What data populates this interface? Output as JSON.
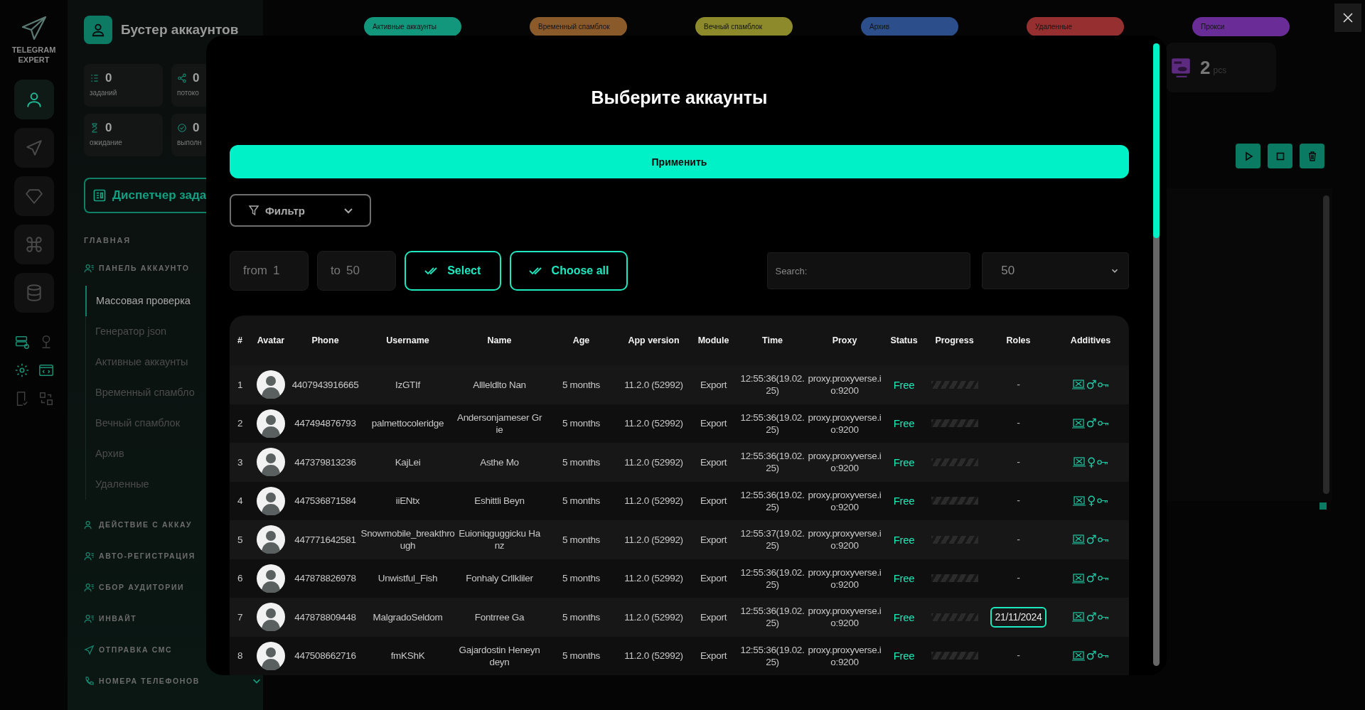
{
  "rail": {
    "logo_text": "TELEGRAM EXPERT",
    "items": [
      {
        "selected": true
      },
      {
        "selected": false
      },
      {
        "selected": false
      },
      {
        "selected": false
      },
      {
        "selected": false
      }
    ]
  },
  "sidebar": {
    "title": "Бустер аккаунтов",
    "stats": [
      {
        "value": "0",
        "label": "заданий"
      },
      {
        "value": "0",
        "label": "потоко"
      },
      {
        "value": "0",
        "label": "ожидание"
      },
      {
        "value": "0",
        "label": "выполн"
      }
    ],
    "dispatcher": "Диспетчер зада",
    "section": "ГЛАВНАЯ",
    "menu": [
      {
        "label": "ПАНЕЛЬ АККАУНТО",
        "children": [
          {
            "label": "Массовая проверка",
            "selected": true
          },
          {
            "label": "Генератор json",
            "selected": false
          },
          {
            "label": "Активные аккаунты",
            "selected": false
          },
          {
            "label": "Временный спамбло",
            "selected": false
          },
          {
            "label": "Вечный спамблок",
            "selected": false
          },
          {
            "label": "Архив",
            "selected": false
          },
          {
            "label": "Удаленные",
            "selected": false
          }
        ]
      },
      {
        "label": "ДЕЙСТВИЕ С АККАУ"
      },
      {
        "label": "АВТО-РЕГИСТРАЦИЯ"
      },
      {
        "label": "СБОР АУДИТОРИИ"
      },
      {
        "label": "ИНВАЙТ"
      },
      {
        "label": "ОТПРАВКА СМС"
      },
      {
        "label": "НОМЕРА ТЕЛЕФОНОВ",
        "expanded": false
      }
    ]
  },
  "status_tabs": [
    {
      "label": "Активные аккаунты",
      "color": "#12967c"
    },
    {
      "label": "Временный спамблок",
      "color": "#8b5a2b"
    },
    {
      "label": "Вечный спамблок",
      "color": "#8c8a2a"
    },
    {
      "label": "Архив",
      "color": "#2c4f8c"
    },
    {
      "label": "Удаленные",
      "color": "#962f2f"
    },
    {
      "label": "Прокси",
      "color": "#6a2d98"
    }
  ],
  "right_panel": {
    "count": "2",
    "unit": "pcs"
  },
  "modal": {
    "title": "Выберите аккаунты",
    "apply": "Применить",
    "filter": "Фильтр",
    "from": {
      "label": "from",
      "value": "1"
    },
    "to": {
      "label": "to",
      "value": "50"
    },
    "select": "Select",
    "choose_all": "Choose all",
    "search": {
      "placeholder": "Search:"
    },
    "per_page": "50",
    "table": {
      "columns": [
        "#",
        "Avatar",
        "Phone",
        "Username",
        "Name",
        "Age",
        "App version",
        "Module",
        "Time",
        "Proxy",
        "Status",
        "Progress",
        "Roles",
        "Additives"
      ],
      "rows": [
        {
          "num": "1",
          "phone": "4407943916665",
          "username": "IzGTIf",
          "name": "Allleldlto Nan",
          "age": "5 months",
          "app_version": "11.2.0 (52992)",
          "module": "Export",
          "time": "12:55:36(19.02.25)",
          "proxy": "proxy.proxyverse.io:9200",
          "status": "Free",
          "progress": {
            "level": 0
          },
          "roles": {
            "kind": "plain",
            "text": "-"
          },
          "gender": "♂"
        },
        {
          "num": "2",
          "phone": "447494876793",
          "username": "palmettocoleridge",
          "name": "Andersonjameser Grie",
          "age": "5 months",
          "app_version": "11.2.0 (52992)",
          "module": "Export",
          "time": "12:55:36(19.02.25)",
          "proxy": "proxy.proxyverse.io:9200",
          "status": "Free",
          "progress": {
            "level": 0
          },
          "roles": {
            "kind": "plain",
            "text": "-"
          },
          "gender": "♂"
        },
        {
          "num": "3",
          "phone": "447379813236",
          "username": "KajLei",
          "name": "Asthe Mo",
          "age": "5 months",
          "app_version": "11.2.0 (52992)",
          "module": "Export",
          "time": "12:55:36(19.02.25)",
          "proxy": "proxy.proxyverse.io:9200",
          "status": "Free",
          "progress": {
            "level": 0
          },
          "roles": {
            "kind": "plain",
            "text": "-"
          },
          "gender": "♀"
        },
        {
          "num": "4",
          "phone": "447536871584",
          "username": "iiENtx",
          "name": "Eshittli Beyn",
          "age": "5 months",
          "app_version": "11.2.0 (52992)",
          "module": "Export",
          "time": "12:55:36(19.02.25)",
          "proxy": "proxy.proxyverse.io:9200",
          "status": "Free",
          "progress": {
            "level": 0
          },
          "roles": {
            "kind": "plain",
            "text": "-"
          },
          "gender": "♀"
        },
        {
          "num": "5",
          "phone": "447771642581",
          "username": "Snowmobile_breakthrough",
          "name": "Euioniqguggicku Hanz",
          "age": "5 months",
          "app_version": "11.2.0 (52992)",
          "module": "Export",
          "time": "12:55:37(19.02.25)",
          "proxy": "proxy.proxyverse.io:9200",
          "status": "Free",
          "progress": {
            "level": 0
          },
          "roles": {
            "kind": "plain",
            "text": "-"
          },
          "gender": "♂"
        },
        {
          "num": "6",
          "phone": "447878826978",
          "username": "Unwistful_Fish",
          "name": "Fonhaly Crllkliler",
          "age": "5 months",
          "app_version": "11.2.0 (52992)",
          "module": "Export",
          "time": "12:55:36(19.02.25)",
          "proxy": "proxy.proxyverse.io:9200",
          "status": "Free",
          "progress": {
            "level": 0
          },
          "roles": {
            "kind": "plain",
            "text": "-"
          },
          "gender": "♂"
        },
        {
          "num": "7",
          "phone": "447878809448",
          "username": "MalgradoSeldom",
          "name": "Fontrree Ga",
          "age": "5 months",
          "app_version": "11.2.0 (52992)",
          "module": "Export",
          "time": "12:55:36(19.02.25)",
          "proxy": "proxy.proxyverse.io:9200",
          "status": "Free",
          "progress": {
            "level": 0
          },
          "roles": {
            "kind": "date",
            "text": "21/11/2024"
          },
          "gender": "♂"
        },
        {
          "num": "8",
          "phone": "447508662716",
          "username": "fmKShK",
          "name": "Gajardostin Heneyndeyn",
          "age": "5 months",
          "app_version": "11.2.0 (52992)",
          "module": "Export",
          "time": "12:55:36(19.02.25)",
          "proxy": "proxy.proxyverse.io:9200",
          "status": "Free",
          "progress": {
            "level": 0
          },
          "roles": {
            "kind": "plain",
            "text": "-"
          },
          "gender": "♂"
        }
      ]
    }
  }
}
